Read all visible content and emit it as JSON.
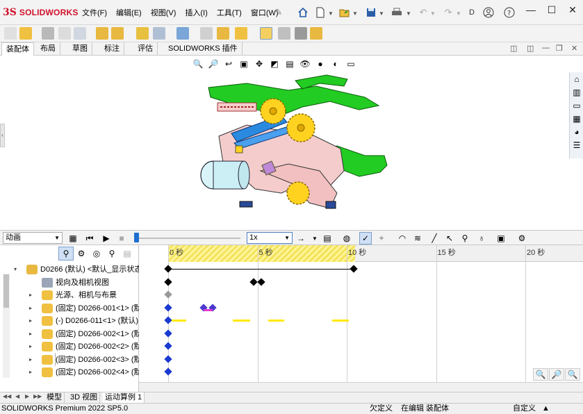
{
  "app": {
    "ds_mark": "3S",
    "brand": "SOLIDWORKS"
  },
  "menu": [
    "文件(F)",
    "编辑(E)",
    "视图(V)",
    "插入(I)",
    "工具(T)",
    "窗口(W)"
  ],
  "title_fragment": "D",
  "window_controls": {
    "minimize": "—",
    "maximize": "☐",
    "close": "✕"
  },
  "tabs": [
    "装配体",
    "布局",
    "草图",
    "标注",
    "评估",
    "SOLIDWORKS 插件"
  ],
  "active_tab": 0,
  "motion_toolbar": {
    "study_type": "动画",
    "speed": "1x"
  },
  "timeline": {
    "ticks": [
      {
        "label": "0 秒",
        "value": 0
      },
      {
        "label": "5 秒",
        "value": 5
      },
      {
        "label": "10 秒",
        "value": 10
      },
      {
        "label": "15 秒",
        "value": 15
      },
      {
        "label": "20 秒",
        "value": 20
      }
    ],
    "playback_end": 10.4
  },
  "tree": [
    {
      "label": "D0266 (默认) <默认_显示状态",
      "twisty": "▾",
      "indent": 0,
      "icon": "assembly-icon"
    },
    {
      "label": "视向及相机视图",
      "twisty": "",
      "indent": 1,
      "icon": "camera-icon"
    },
    {
      "label": "光源、相机与布景",
      "twisty": "▸",
      "indent": 1,
      "icon": "lights-folder-icon"
    },
    {
      "label": "(固定) D0266-001<1> (默",
      "twisty": "▸",
      "indent": 1,
      "icon": "part-icon"
    },
    {
      "label": "(-) D0266-011<1> (默认)",
      "twisty": "▸",
      "indent": 1,
      "icon": "part-icon"
    },
    {
      "label": "(固定) D0266-002<1> (默",
      "twisty": "▸",
      "indent": 1,
      "icon": "part-icon"
    },
    {
      "label": "(固定) D0266-002<2> (默",
      "twisty": "▸",
      "indent": 1,
      "icon": "part-icon"
    },
    {
      "label": "(固定) D0266-002<3> (默",
      "twisty": "▸",
      "indent": 1,
      "icon": "part-icon",
      "selected": true
    },
    {
      "label": "(固定) D0266-002<4> (默",
      "twisty": "▸",
      "indent": 1,
      "icon": "part-icon"
    }
  ],
  "bottom_tabs": [
    "模型",
    "3D 视图",
    "运动算例 1"
  ],
  "active_bottom_tab": 2,
  "status": {
    "product": "SOLIDWORKS Premium 2022 SP5.0",
    "undefined": "欠定义",
    "editing": "在编辑 装配体",
    "custom": "自定义"
  }
}
